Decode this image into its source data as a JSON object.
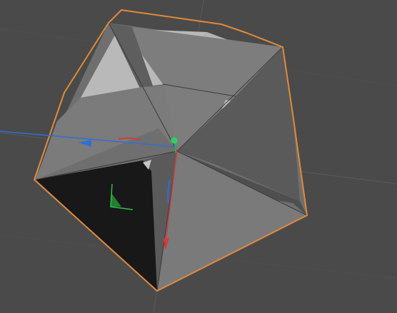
{
  "viewport": {
    "background": "#4a4a4a",
    "grid_color": "#5a5a5a",
    "selection_outline_color": "#e08a3a"
  },
  "axes": {
    "x_color": "#2f6fd0",
    "y_color": "#d23a3a",
    "z_color": "#2fc04a"
  },
  "object": {
    "selected": true,
    "face_colors": {
      "light": "#b9b9b9",
      "mid": "#7a7a7a",
      "dark": "#4f4f4f",
      "black": "#181818"
    }
  },
  "icons": {
    "pivot": "pivot-dot-icon",
    "x_arrow": "x-axis-arrow-icon",
    "y_arrow": "y-axis-arrow-icon",
    "rotate_x": "rotate-x-handle-icon",
    "rotate_y": "rotate-y-handle-icon",
    "rotate_z": "rotate-z-handle-icon"
  }
}
